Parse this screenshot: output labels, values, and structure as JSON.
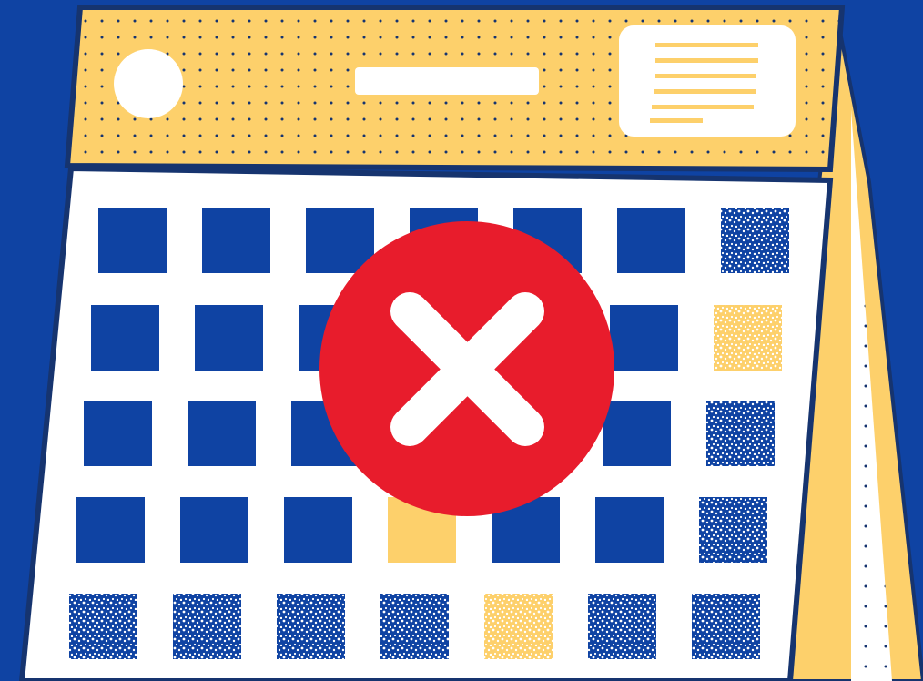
{
  "scene": {
    "colors": {
      "background": "#0f43a3",
      "header_yellow": "#fdd06b",
      "paper_white": "#ffffff",
      "cell_blue": "#0f43a3",
      "cell_yellow": "#fdd06b",
      "cancel_red": "#e81c2c",
      "outline_navy": "#16346f"
    },
    "icons": {
      "overlay": "x-circle-icon",
      "calendar": "calendar-icon"
    },
    "grid": {
      "rows": 5,
      "columns": 7,
      "highlighted_cells": [
        {
          "row": 1,
          "column": 6,
          "color": "yellow"
        },
        {
          "row": 3,
          "column": 3,
          "color": "yellow"
        },
        {
          "row": 4,
          "column": 4,
          "color": "yellow"
        }
      ]
    }
  }
}
